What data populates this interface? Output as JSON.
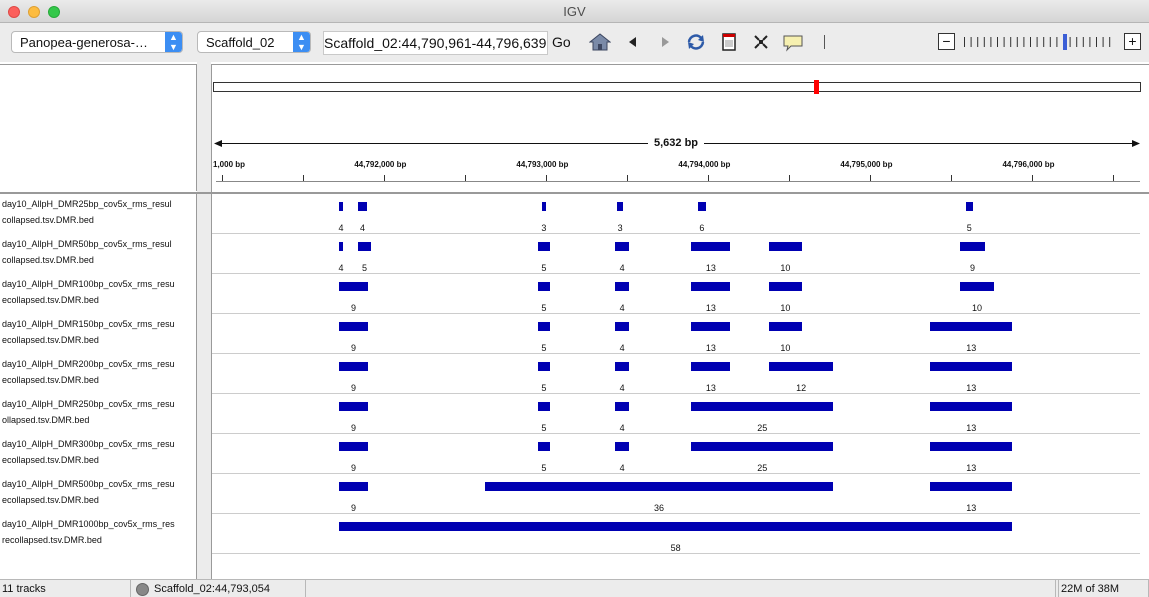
{
  "window": {
    "title": "IGV"
  },
  "toolbar": {
    "genome": "Panopea-generosa-…",
    "chromosome": "Scaffold_02",
    "locus": "Scaffold_02:44,790,961-44,796,639",
    "go_label": "Go",
    "zoom_minus": "−",
    "zoom_plus": "+",
    "zoom_level_fraction": 0.68
  },
  "ruler": {
    "span_label": "5,632 bp",
    "ideogram_marker_fraction": 0.65,
    "range_start": 44790961,
    "range_end": 44796639,
    "ticks": [
      {
        "label": "1,000 bp",
        "pos": 44791000
      },
      {
        "label": "44,792,000 bp",
        "pos": 44792000
      },
      {
        "label": "44,793,000 bp",
        "pos": 44793000
      },
      {
        "label": "44,794,000 bp",
        "pos": 44794000
      },
      {
        "label": "44,795,000 bp",
        "pos": 44795000
      },
      {
        "label": "44,796,000 bp",
        "pos": 44796000
      }
    ],
    "minor_ticks": [
      44791500,
      44792500,
      44793500,
      44794500,
      44795500,
      44796500
    ]
  },
  "tracks": [
    {
      "line1": "day10_AllpH_DMR25bp_cov5x_rms_resul",
      "line2": "collapsed.tsv.DMR.bed",
      "features": [
        {
          "start": 44791720,
          "end": 44791745,
          "label": "4"
        },
        {
          "start": 44791840,
          "end": 44791890,
          "label": "4"
        },
        {
          "start": 44792975,
          "end": 44792995,
          "label": "3"
        },
        {
          "start": 44793435,
          "end": 44793475,
          "label": "3"
        },
        {
          "start": 44793935,
          "end": 44793985,
          "label": "6"
        },
        {
          "start": 44795590,
          "end": 44795630,
          "label": "5"
        }
      ]
    },
    {
      "line1": "day10_AllpH_DMR50bp_cov5x_rms_resul",
      "line2": "collapsed.tsv.DMR.bed",
      "features": [
        {
          "start": 44791720,
          "end": 44791745,
          "label": "4"
        },
        {
          "start": 44791840,
          "end": 44791915,
          "label": "5"
        },
        {
          "start": 44792950,
          "end": 44793020,
          "label": "5"
        },
        {
          "start": 44793425,
          "end": 44793510,
          "label": "4"
        },
        {
          "start": 44793895,
          "end": 44794135,
          "label": "13"
        },
        {
          "start": 44794375,
          "end": 44794575,
          "label": "10"
        },
        {
          "start": 44795550,
          "end": 44795710,
          "label": "9"
        }
      ]
    },
    {
      "line1": "day10_AllpH_DMR100bp_cov5x_rms_resu",
      "line2": "ecollapsed.tsv.DMR.bed",
      "features": [
        {
          "start": 44791720,
          "end": 44791900,
          "label": "9"
        },
        {
          "start": 44792950,
          "end": 44793020,
          "label": "5"
        },
        {
          "start": 44793425,
          "end": 44793510,
          "label": "4"
        },
        {
          "start": 44793895,
          "end": 44794135,
          "label": "13"
        },
        {
          "start": 44794375,
          "end": 44794575,
          "label": "10"
        },
        {
          "start": 44795550,
          "end": 44795765,
          "label": "10"
        }
      ]
    },
    {
      "line1": "day10_AllpH_DMR150bp_cov5x_rms_resu",
      "line2": "ecollapsed.tsv.DMR.bed",
      "features": [
        {
          "start": 44791720,
          "end": 44791900,
          "label": "9"
        },
        {
          "start": 44792950,
          "end": 44793020,
          "label": "5"
        },
        {
          "start": 44793425,
          "end": 44793510,
          "label": "4"
        },
        {
          "start": 44793895,
          "end": 44794135,
          "label": "13"
        },
        {
          "start": 44794375,
          "end": 44794575,
          "label": "10"
        },
        {
          "start": 44795370,
          "end": 44795875,
          "label": "13"
        }
      ]
    },
    {
      "line1": "day10_AllpH_DMR200bp_cov5x_rms_resu",
      "line2": "ecollapsed.tsv.DMR.bed",
      "features": [
        {
          "start": 44791720,
          "end": 44791900,
          "label": "9"
        },
        {
          "start": 44792950,
          "end": 44793020,
          "label": "5"
        },
        {
          "start": 44793425,
          "end": 44793510,
          "label": "4"
        },
        {
          "start": 44793895,
          "end": 44794135,
          "label": "13"
        },
        {
          "start": 44794375,
          "end": 44794770,
          "label": "12"
        },
        {
          "start": 44795370,
          "end": 44795875,
          "label": "13"
        }
      ]
    },
    {
      "line1": "day10_AllpH_DMR250bp_cov5x_rms_resu",
      "line2": "ollapsed.tsv.DMR.bed",
      "features": [
        {
          "start": 44791720,
          "end": 44791900,
          "label": "9"
        },
        {
          "start": 44792950,
          "end": 44793020,
          "label": "5"
        },
        {
          "start": 44793425,
          "end": 44793510,
          "label": "4"
        },
        {
          "start": 44793895,
          "end": 44794770,
          "label": "25"
        },
        {
          "start": 44795370,
          "end": 44795875,
          "label": "13"
        }
      ]
    },
    {
      "line1": "day10_AllpH_DMR300bp_cov5x_rms_resu",
      "line2": "ecollapsed.tsv.DMR.bed",
      "features": [
        {
          "start": 44791720,
          "end": 44791900,
          "label": "9"
        },
        {
          "start": 44792950,
          "end": 44793020,
          "label": "5"
        },
        {
          "start": 44793425,
          "end": 44793510,
          "label": "4"
        },
        {
          "start": 44793895,
          "end": 44794770,
          "label": "25"
        },
        {
          "start": 44795370,
          "end": 44795875,
          "label": "13"
        }
      ]
    },
    {
      "line1": "day10_AllpH_DMR500bp_cov5x_rms_resu",
      "line2": "ecollapsed.tsv.DMR.bed",
      "features": [
        {
          "start": 44791720,
          "end": 44791900,
          "label": "9"
        },
        {
          "start": 44792620,
          "end": 44794770,
          "label": "36"
        },
        {
          "start": 44795370,
          "end": 44795875,
          "label": "13"
        }
      ]
    },
    {
      "line1": "day10_AllpH_DMR1000bp_cov5x_rms_res",
      "line2": "recollapsed.tsv.DMR.bed",
      "features": [
        {
          "start": 44791720,
          "end": 44795875,
          "label": "58"
        }
      ]
    }
  ],
  "status": {
    "track_count": "11 tracks",
    "position": "Scaffold_02:44,793,054",
    "memory": "22M of 38M"
  }
}
